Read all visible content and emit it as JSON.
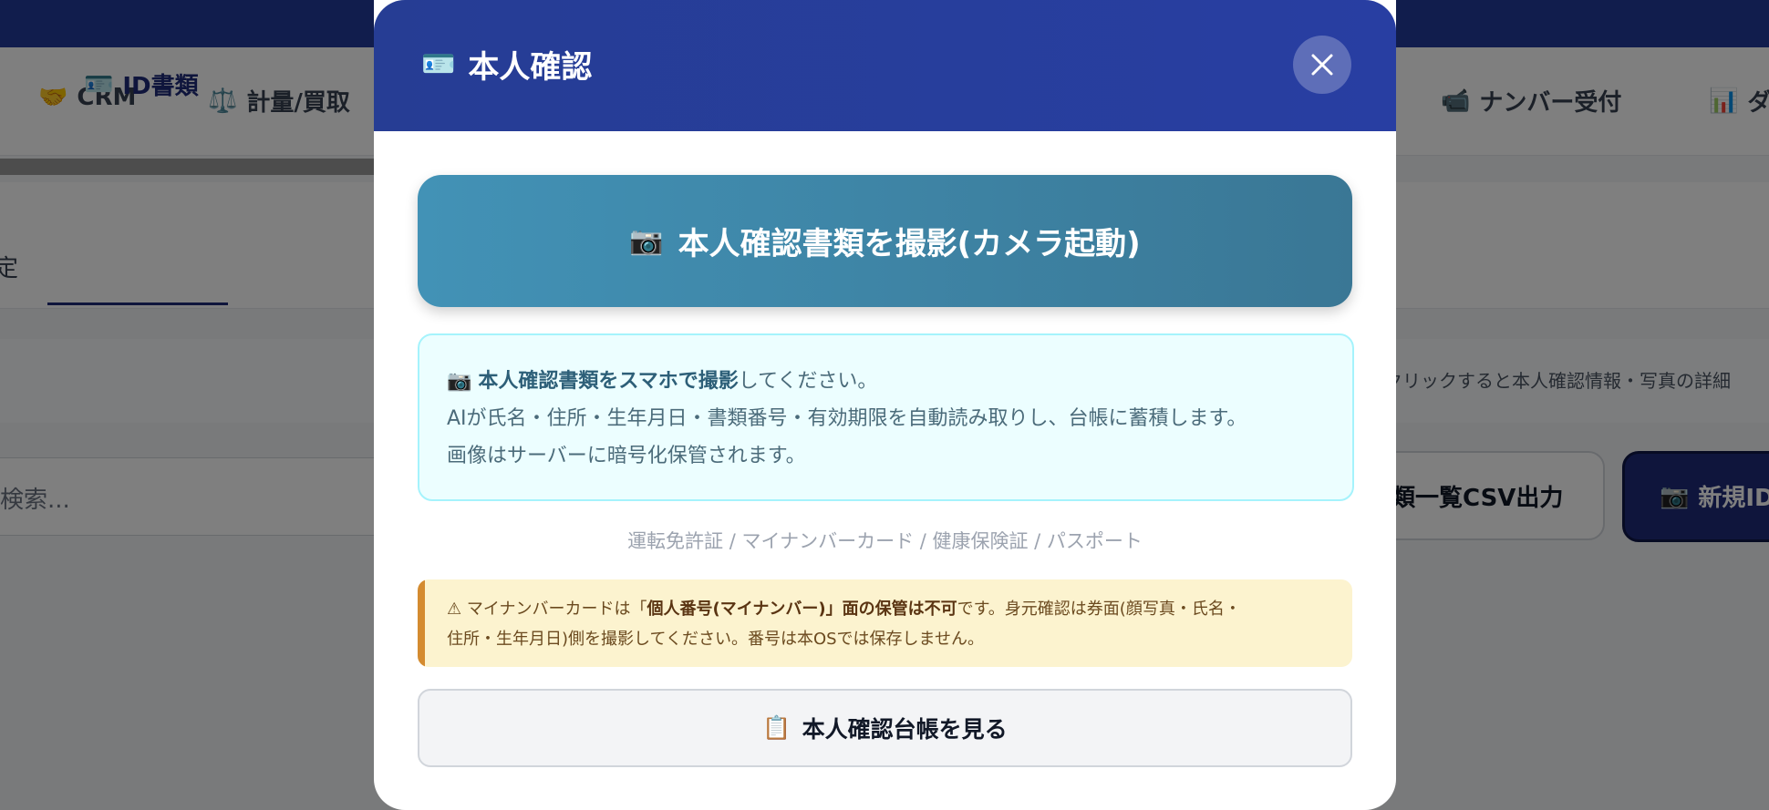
{
  "background": {
    "nav": [
      {
        "icon": "🤝",
        "label": "CRM"
      },
      {
        "icon": "⚖️",
        "label": "計量/買取"
      },
      {
        "icon": "📹",
        "label": "ナンバー受付"
      },
      {
        "icon": "📊",
        "label": "ダ"
      }
    ],
    "tab_partial": "定",
    "tab_active": {
      "icon": "🪪",
      "label": "ID書類"
    },
    "hint": "クリックすると本人確認情報・写真の詳細",
    "search_placeholder": "検索...",
    "csv_button": "類一覧CSV出力",
    "new_button": {
      "icon": "📷",
      "label": "新規ID"
    }
  },
  "modal": {
    "title_icon": "🪪",
    "title": "本人確認",
    "close_label": "×",
    "camera_button": {
      "icon": "📷",
      "label": "本人確認書類を撮影(カメラ起動)"
    },
    "info": {
      "icon": "📷",
      "bold": "本人確認書類をスマホで撮影",
      "rest": "してください。",
      "line2": "AIが氏名・住所・生年月日・書類番号・有効期限を自動読み取りし、台帳に蓄積します。",
      "line3": "画像はサーバーに暗号化保管されます。"
    },
    "doc_types": "運転免許証 / マイナンバーカード / 健康保険証 / パスポート",
    "warning": {
      "icon": "⚠",
      "pre": "マイナンバーカードは「",
      "bold": "個人番号(マイナンバー)」面の保管は不可",
      "post": "です。身元確認は券面(顔写真・氏名・",
      "line2": "住所・生年月日)側を撮影してください。番号は本OSでは保存しません。"
    },
    "ledger_button": {
      "icon": "📋",
      "label": "本人確認台帳を見る"
    }
  },
  "colors": {
    "header": "#263d94",
    "camera_button": "#3f86a8",
    "info_bg": "#ecfeff",
    "warning_bg": "#fcf3cf",
    "warning_accent": "#d48b30"
  }
}
